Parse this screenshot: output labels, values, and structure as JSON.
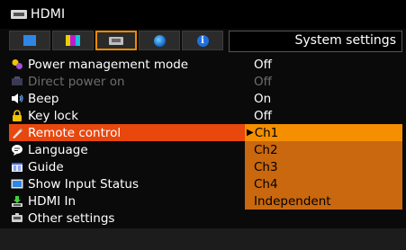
{
  "header": {
    "title": "HDMI"
  },
  "tabs": {
    "items": [
      {
        "icon": "display-icon"
      },
      {
        "icon": "color-bars-icon"
      },
      {
        "icon": "projector-icon",
        "active": true
      },
      {
        "icon": "globe-icon"
      },
      {
        "icon": "info-icon",
        "glyph": "i"
      }
    ],
    "section_title": "System settings"
  },
  "menu": {
    "items": [
      {
        "label": "Power management mode",
        "value": "Off",
        "icon": "power-management-icon"
      },
      {
        "label": "Direct power on",
        "value": "Off",
        "icon": "direct-power-icon",
        "disabled": true
      },
      {
        "label": "Beep",
        "value": "On",
        "icon": "speaker-icon"
      },
      {
        "label": "Key lock",
        "value": "Off",
        "icon": "lock-icon"
      },
      {
        "label": "Remote control",
        "value": "Ch1",
        "icon": "remote-control-icon",
        "selected": true
      },
      {
        "label": "Language",
        "value": "Ch2",
        "icon": "language-icon"
      },
      {
        "label": "Guide",
        "value": "Ch3",
        "icon": "guide-icon"
      },
      {
        "label": "Show Input Status",
        "value": "Ch4",
        "icon": "input-status-icon"
      },
      {
        "label": "HDMI In",
        "value": "Independent",
        "icon": "hdmi-in-icon"
      },
      {
        "label": "Other settings",
        "value": "",
        "icon": "other-settings-icon"
      }
    ],
    "cursor_glyph": "▶"
  },
  "colors": {
    "accent_orange": "#f58f00",
    "selected_label": "#e8470e",
    "option_bg": "#c9680e",
    "disabled_text": "#6e6e6e"
  }
}
